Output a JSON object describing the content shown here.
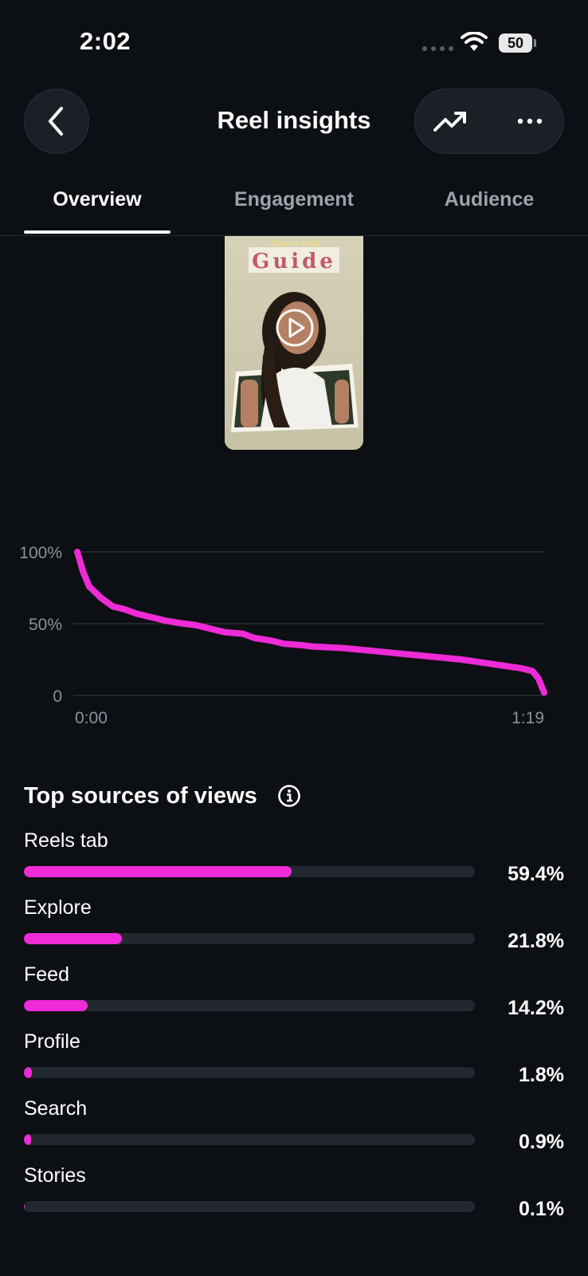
{
  "status_bar": {
    "time": "2:02",
    "battery": "50",
    "icons": [
      "cellular-dots-icon",
      "wifi-icon",
      "battery-icon"
    ]
  },
  "header": {
    "title": "Reel insights",
    "back_icon": "chevron-left-icon",
    "trend_icon": "trending-up-icon",
    "more_icon": "more-horizontal-icon"
  },
  "tabs": [
    {
      "label": "Overview",
      "active": true
    },
    {
      "label": "Engagement",
      "active": false
    },
    {
      "label": "Audience",
      "active": false
    }
  ],
  "thumbnail": {
    "overlay_text_top": "Lingerie haul",
    "overlay_text_main": "Guide",
    "play_icon": "play-icon"
  },
  "retention_chart": {
    "y_ticks": [
      "100%",
      "50%",
      "0"
    ],
    "x_ticks": [
      "0:00",
      "1:19"
    ]
  },
  "chart_data": {
    "type": "line",
    "title": "",
    "xlabel": "",
    "ylabel": "",
    "x_range": [
      "0:00",
      "1:19"
    ],
    "ylim": [
      0,
      100
    ],
    "grid": true,
    "series": [
      {
        "color": "#ee2bd6",
        "x_seconds": [
          0,
          1,
          2,
          3,
          4,
          6,
          8,
          10,
          12,
          15,
          18,
          20,
          23,
          25,
          28,
          30,
          33,
          35,
          38,
          40,
          45,
          50,
          55,
          60,
          65,
          70,
          75,
          77,
          78,
          79
        ],
        "values": [
          100,
          86,
          76,
          72,
          68,
          62,
          60,
          57,
          55,
          52,
          50,
          49,
          46,
          44,
          43,
          40,
          38,
          36,
          35,
          34,
          33,
          31,
          29,
          27,
          25,
          22,
          19,
          17,
          12,
          2
        ]
      }
    ]
  },
  "sources": {
    "title": "Top sources of views",
    "info_icon": "info-icon",
    "fill_color": "#ee2bd6",
    "items": [
      {
        "label": "Reels tab",
        "value": "59.4%",
        "pct": 59.4
      },
      {
        "label": "Explore",
        "value": "21.8%",
        "pct": 21.8
      },
      {
        "label": "Feed",
        "value": "14.2%",
        "pct": 14.2
      },
      {
        "label": "Profile",
        "value": "1.8%",
        "pct": 1.8
      },
      {
        "label": "Search",
        "value": "0.9%",
        "pct": 0.9
      },
      {
        "label": "Stories",
        "value": "0.1%",
        "pct": 0.1
      }
    ]
  }
}
